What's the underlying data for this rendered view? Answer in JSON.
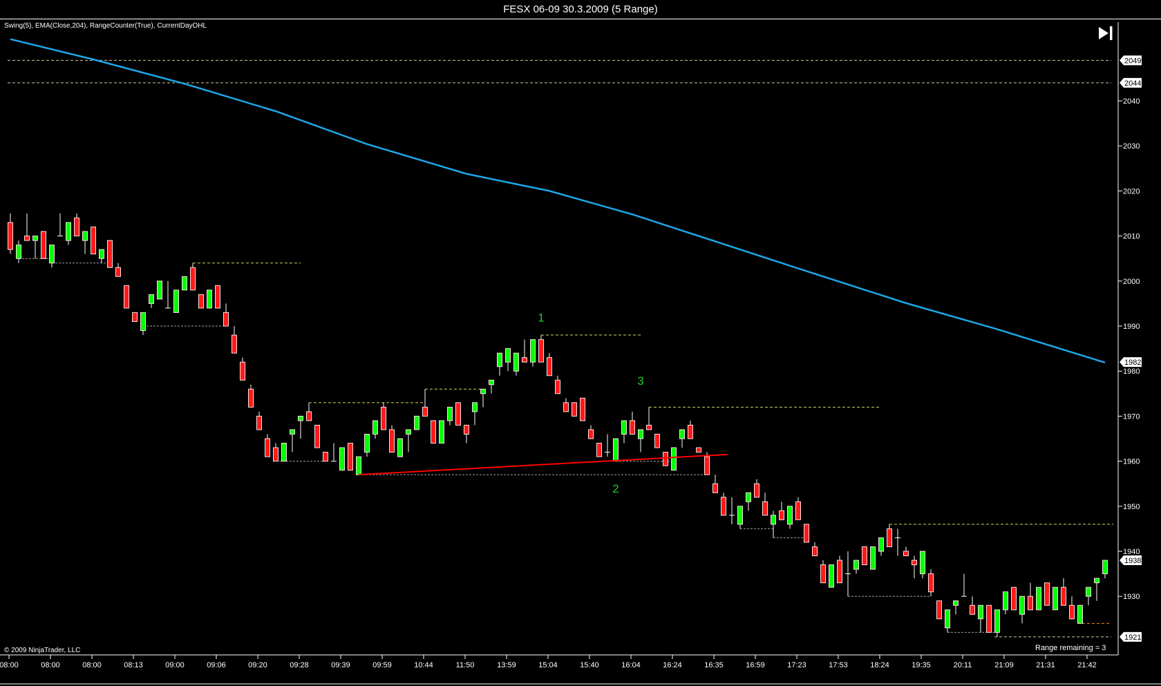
{
  "window": {
    "title": "FESX 06-09  30.3.2009 (5 Range)"
  },
  "indicators_label": "Swing(5), EMA(Close,204), RangeCounter(True), CurrentDayOHL",
  "copyright": "© 2009 NinjaTrader, LLC",
  "range_remaining": "Range remaining = 3",
  "colors": {
    "up": "#00ff00",
    "down": "#ff1a1a",
    "ema": "#1ea7e8",
    "swing_high": "#d8d860",
    "swing_low": "#a0a0a0",
    "trendline": "#ff0000",
    "label": "#22cc22"
  },
  "chart_data": {
    "type": "candlestick",
    "title": "FESX 06-09  30.3.2009 (5 Range)",
    "ylim": [
      1915,
      2056
    ],
    "y_ticks": [
      2040,
      2030,
      2020,
      2010,
      2000,
      1990,
      1980,
      1970,
      1960,
      1950,
      1940,
      1930
    ],
    "y_ticks_labels": [
      "2040",
      "2030",
      "2020",
      "2010",
      "2000",
      "1990",
      "1980",
      "1970",
      "1960",
      "1950",
      "1940",
      "1930"
    ],
    "price_tags": [
      {
        "value": 2049,
        "label": "2049"
      },
      {
        "value": 2044,
        "label": "2044"
      },
      {
        "value": 1982,
        "label": "1982"
      },
      {
        "value": 1938,
        "label": "1938"
      },
      {
        "value": 1921,
        "label": "1921"
      }
    ],
    "x_labels": [
      "08:00",
      "08:00",
      "08:00",
      "08:13",
      "09:00",
      "09:06",
      "09:20",
      "09:28",
      "09:39",
      "09:59",
      "10:44",
      "11:50",
      "13:59",
      "15:04",
      "15:40",
      "16:04",
      "16:24",
      "16:35",
      "16:59",
      "17:23",
      "17:53",
      "18:24",
      "19:35",
      "20:11",
      "21:09",
      "21:31",
      "21:42"
    ],
    "x_label_every_bars": 5,
    "ohlc": [
      [
        2013,
        2015,
        2006,
        2007
      ],
      [
        2005,
        2009,
        2004,
        2008
      ],
      [
        2010,
        2015,
        2009,
        2009
      ],
      [
        2009,
        2010,
        2005,
        2010
      ],
      [
        2011,
        2011,
        2005,
        2005
      ],
      [
        2004,
        2008,
        2003,
        2008
      ],
      [
        2010,
        2015,
        2010,
        2010
      ],
      [
        2009,
        2013,
        2008,
        2013
      ],
      [
        2014,
        2015,
        2010,
        2010
      ],
      [
        2009,
        2011,
        2006,
        2011
      ],
      [
        2012,
        2012,
        2006,
        2006
      ],
      [
        2005,
        2007,
        2004,
        2007
      ],
      [
        2009,
        2009,
        2003,
        2003
      ],
      [
        2003,
        2004,
        2001,
        2001
      ],
      [
        1999,
        1999,
        1994,
        1994
      ],
      [
        1993,
        1993,
        1991,
        1991
      ],
      [
        1989,
        1993,
        1988,
        1993
      ],
      [
        1995,
        1997,
        1994,
        1997
      ],
      [
        1996,
        2000,
        1996,
        2000
      ],
      [
        1994,
        2000,
        1994,
        1994
      ],
      [
        1993,
        1998,
        1993,
        1998
      ],
      [
        1998,
        2001,
        1998,
        2001
      ],
      [
        2003,
        2004,
        1998,
        1998
      ],
      [
        1997,
        1997,
        1994,
        1994
      ],
      [
        1994,
        1998,
        1994,
        1998
      ],
      [
        1999,
        1999,
        1994,
        1994
      ],
      [
        1993,
        1995,
        1990,
        1990
      ],
      [
        1988,
        1990,
        1984,
        1984
      ],
      [
        1982,
        1983,
        1978,
        1978
      ],
      [
        1976,
        1977,
        1972,
        1972
      ],
      [
        1970,
        1971,
        1967,
        1967
      ],
      [
        1965,
        1966,
        1961,
        1961
      ],
      [
        1963,
        1964,
        1960,
        1960
      ],
      [
        1960,
        1964,
        1960,
        1964
      ],
      [
        1966,
        1967,
        1962,
        1967
      ],
      [
        1969,
        1970,
        1965,
        1970
      ],
      [
        1971,
        1973,
        1969,
        1969
      ],
      [
        1968,
        1968,
        1963,
        1963
      ],
      [
        1962,
        1962,
        1960,
        1960
      ],
      [
        1960,
        1964,
        1960,
        1960
      ],
      [
        1958,
        1963,
        1958,
        1963
      ],
      [
        1964,
        1964,
        1958,
        1958
      ],
      [
        1957,
        1961,
        1957,
        1961
      ],
      [
        1962,
        1966,
        1961,
        1966
      ],
      [
        1966,
        1969,
        1965,
        1969
      ],
      [
        1972,
        1973,
        1967,
        1967
      ],
      [
        1967,
        1968,
        1962,
        1962
      ],
      [
        1961,
        1965,
        1961,
        1965
      ],
      [
        1966,
        1967,
        1962,
        1967
      ],
      [
        1967,
        1970,
        1967,
        1970
      ],
      [
        1972,
        1976,
        1970,
        1970
      ],
      [
        1969,
        1969,
        1964,
        1964
      ],
      [
        1964,
        1969,
        1964,
        1969
      ],
      [
        1969,
        1972,
        1968,
        1972
      ],
      [
        1973,
        1973,
        1968,
        1968
      ],
      [
        1968,
        1968,
        1964,
        1966
      ],
      [
        1971,
        1973,
        1968,
        1973
      ],
      [
        1975,
        1976,
        1972,
        1976
      ],
      [
        1977,
        1978,
        1975,
        1978
      ],
      [
        1981,
        1984,
        1979,
        1984
      ],
      [
        1982,
        1985,
        1980,
        1985
      ],
      [
        1980,
        1984,
        1979,
        1984
      ],
      [
        1983,
        1987,
        1982,
        1982
      ],
      [
        1982,
        1987,
        1981,
        1987
      ],
      [
        1987,
        1988,
        1982,
        1982
      ],
      [
        1983,
        1984,
        1979,
        1979
      ],
      [
        1978,
        1979,
        1975,
        1975
      ],
      [
        1973,
        1974,
        1971,
        1971
      ],
      [
        1973,
        1973,
        1970,
        1970
      ],
      [
        1974,
        1974,
        1969,
        1969
      ],
      [
        1967,
        1968,
        1965,
        1965
      ],
      [
        1964,
        1964,
        1961,
        1961
      ],
      [
        1962,
        1966,
        1961,
        1962
      ],
      [
        1960,
        1965,
        1960,
        1965
      ],
      [
        1966,
        1969,
        1964,
        1969
      ],
      [
        1969,
        1971,
        1966,
        1966
      ],
      [
        1965,
        1967,
        1962,
        1967
      ],
      [
        1968,
        1972,
        1967,
        1967
      ],
      [
        1966,
        1966,
        1963,
        1963
      ],
      [
        1962,
        1962,
        1959,
        1959
      ],
      [
        1958,
        1963,
        1958,
        1963
      ],
      [
        1965,
        1967,
        1963,
        1967
      ],
      [
        1968,
        1969,
        1965,
        1965
      ],
      [
        1963,
        1963,
        1962,
        1962
      ],
      [
        1961,
        1962,
        1957,
        1957
      ],
      [
        1955,
        1957,
        1953,
        1953
      ],
      [
        1952,
        1953,
        1948,
        1948
      ],
      [
        1948,
        1952,
        1946,
        1948
      ],
      [
        1946,
        1950,
        1945,
        1950
      ],
      [
        1951,
        1953,
        1949,
        1953
      ],
      [
        1955,
        1956,
        1952,
        1952
      ],
      [
        1951,
        1953,
        1948,
        1948
      ],
      [
        1946,
        1949,
        1943,
        1948
      ],
      [
        1949,
        1951,
        1947,
        1947
      ],
      [
        1946,
        1950,
        1945,
        1950
      ],
      [
        1951,
        1952,
        1947,
        1947
      ],
      [
        1946,
        1946,
        1942,
        1942
      ],
      [
        1941,
        1942,
        1939,
        1939
      ],
      [
        1937,
        1938,
        1933,
        1933
      ],
      [
        1932,
        1937,
        1932,
        1937
      ],
      [
        1938,
        1939,
        1933,
        1933
      ],
      [
        1935,
        1940,
        1930,
        1935
      ],
      [
        1936,
        1938,
        1935,
        1938
      ],
      [
        1941,
        1941,
        1937,
        1937
      ],
      [
        1936,
        1941,
        1936,
        1941
      ],
      [
        1940,
        1943,
        1939,
        1943
      ],
      [
        1945,
        1946,
        1941,
        1941
      ],
      [
        1943,
        1945,
        1939,
        1943
      ],
      [
        1940,
        1941,
        1939,
        1939
      ],
      [
        1938,
        1939,
        1934,
        1937
      ],
      [
        1935,
        1940,
        1934,
        1940
      ],
      [
        1935,
        1936,
        1930,
        1931
      ],
      [
        1929,
        1929,
        1925,
        1925
      ],
      [
        1923,
        1927,
        1922,
        1927
      ],
      [
        1928,
        1929,
        1926,
        1929
      ],
      [
        1930,
        1935,
        1930,
        1930
      ],
      [
        1928,
        1930,
        1926,
        1926
      ],
      [
        1925,
        1928,
        1922,
        1928
      ],
      [
        1928,
        1928,
        1922,
        1922
      ],
      [
        1922,
        1927,
        1921,
        1927
      ],
      [
        1927,
        1931,
        1926,
        1931
      ],
      [
        1932,
        1932,
        1927,
        1927
      ],
      [
        1926,
        1930,
        1924,
        1930
      ],
      [
        1930,
        1933,
        1927,
        1927
      ],
      [
        1927,
        1932,
        1927,
        1932
      ],
      [
        1933,
        1933,
        1928,
        1928
      ],
      [
        1927,
        1932,
        1927,
        1932
      ],
      [
        1932,
        1934,
        1928,
        1928
      ],
      [
        1928,
        1930,
        1925,
        1925
      ],
      [
        1924,
        1928,
        1924,
        1928
      ],
      [
        1930,
        1932,
        1928,
        1932
      ],
      [
        1933,
        1934,
        1929,
        1934
      ],
      [
        1935,
        1938,
        1934,
        1938
      ]
    ],
    "ema": {
      "name": "EMA(Close,204)",
      "bars": [
        0,
        10,
        21,
        32,
        43,
        55,
        65,
        75,
        86,
        97,
        108,
        119,
        132
      ],
      "values": [
        2053.7,
        2049.2,
        2043.8,
        2037.7,
        2030.4,
        2023.8,
        2020.0,
        2014.8,
        2008.2,
        2001.6,
        1995.1,
        1989.3,
        1981.9
      ]
    },
    "day_levels": [
      {
        "value": 2049,
        "from": 0
      },
      {
        "value": 2044,
        "from": 0
      },
      {
        "value": 1921,
        "from": 119
      },
      {
        "value": 1924,
        "from": 129
      }
    ],
    "swing_highs": [
      {
        "value": 2004,
        "from": 22,
        "to": 35
      },
      {
        "value": 1973,
        "from": 36,
        "to": 50
      },
      {
        "value": 1976,
        "from": 50,
        "to": 57
      },
      {
        "value": 1988,
        "from": 64,
        "to": 76
      },
      {
        "value": 1972,
        "from": 77,
        "to": 105
      },
      {
        "value": 1946,
        "from": 106,
        "to": 133
      }
    ],
    "swing_lows": [
      {
        "value": 2005,
        "from": 1,
        "to": 5
      },
      {
        "value": 2004,
        "from": 5,
        "to": 12
      },
      {
        "value": 1990,
        "from": 16,
        "to": 26
      },
      {
        "value": 1960,
        "from": 32,
        "to": 38
      },
      {
        "value": 1957,
        "from": 42,
        "to": 84
      },
      {
        "value": 1960,
        "from": 73,
        "to": 80
      },
      {
        "value": 1945,
        "from": 88,
        "to": 92
      },
      {
        "value": 1943,
        "from": 92,
        "to": 96
      },
      {
        "value": 1930,
        "from": 101,
        "to": 111
      },
      {
        "value": 1922,
        "from": 113,
        "to": 119
      }
    ],
    "trendline": {
      "from_bar": 42,
      "from_value": 1957,
      "to_bar": 86,
      "to_value": 1961.5
    },
    "annotations": [
      {
        "text": "1",
        "bar": 64,
        "value": 1991
      },
      {
        "text": "2",
        "bar": 73,
        "value": 1953
      },
      {
        "text": "3",
        "bar": 76,
        "value": 1977
      }
    ]
  }
}
